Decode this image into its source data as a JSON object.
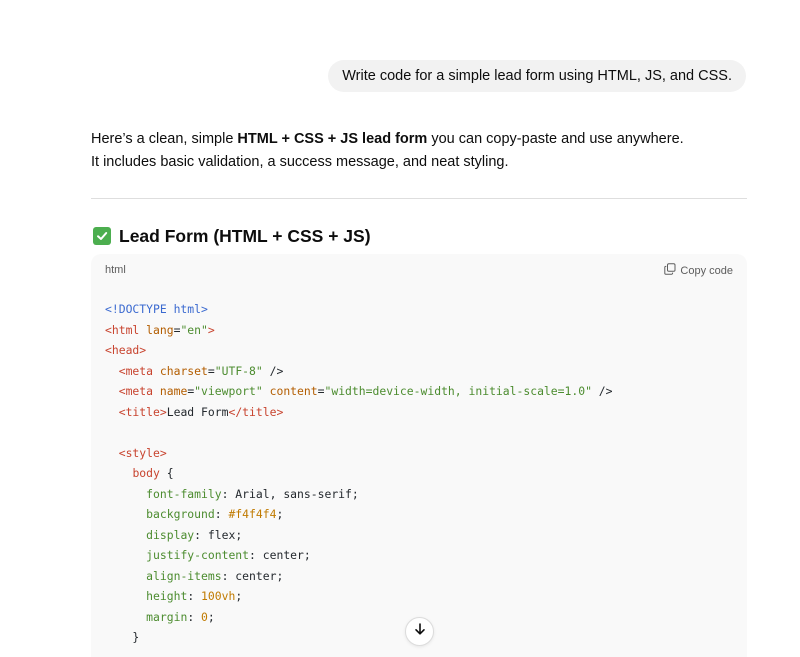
{
  "user_message": "Write code for a simple lead form using HTML, JS, and CSS.",
  "answer": {
    "line1_prefix": "Here’s a clean, simple ",
    "line1_bold": "HTML + CSS + JS lead form",
    "line1_suffix": " you can copy-paste and use anywhere.",
    "line2": "It includes basic validation, a success message, and neat styling."
  },
  "section": {
    "icon": "check-mark-icon",
    "title": "Lead Form (HTML + CSS + JS)"
  },
  "code_block": {
    "language": "html",
    "copy_label": "Copy code",
    "lines": [
      [
        [
          "doc",
          "<!DOCTYPE "
        ],
        [
          "doc",
          "html"
        ],
        [
          "doc",
          ">"
        ]
      ],
      [
        [
          "tag",
          "<html "
        ],
        [
          "attr",
          "lang"
        ],
        [
          "punct",
          "="
        ],
        [
          "str",
          "\"en\""
        ],
        [
          "tag",
          ">"
        ]
      ],
      [
        [
          "tag",
          "<head>"
        ]
      ],
      [
        [
          "punct",
          "  "
        ],
        [
          "tag",
          "<meta "
        ],
        [
          "attr",
          "charset"
        ],
        [
          "punct",
          "="
        ],
        [
          "str",
          "\"UTF-8\""
        ],
        [
          "punct",
          " />"
        ]
      ],
      [
        [
          "punct",
          "  "
        ],
        [
          "tag",
          "<meta "
        ],
        [
          "attr",
          "name"
        ],
        [
          "punct",
          "="
        ],
        [
          "str",
          "\"viewport\""
        ],
        [
          "punct",
          " "
        ],
        [
          "attr",
          "content"
        ],
        [
          "punct",
          "="
        ],
        [
          "str",
          "\"width=device-width, initial-scale=1.0\""
        ],
        [
          "punct",
          " />"
        ]
      ],
      [
        [
          "punct",
          "  "
        ],
        [
          "tag",
          "<title>"
        ],
        [
          "punct",
          "Lead Form"
        ],
        [
          "tag",
          "</title>"
        ]
      ],
      [
        [
          "punct",
          ""
        ]
      ],
      [
        [
          "punct",
          "  "
        ],
        [
          "tag",
          "<style>"
        ]
      ],
      [
        [
          "punct",
          "    "
        ],
        [
          "sel",
          "body"
        ],
        [
          "punct",
          " {"
        ]
      ],
      [
        [
          "punct",
          "      "
        ],
        [
          "prop",
          "font-family"
        ],
        [
          "punct",
          ": Arial, sans-serif;"
        ]
      ],
      [
        [
          "punct",
          "      "
        ],
        [
          "prop",
          "background"
        ],
        [
          "punct",
          ": "
        ],
        [
          "num",
          "#f4f4f4"
        ],
        [
          "punct",
          ";"
        ]
      ],
      [
        [
          "punct",
          "      "
        ],
        [
          "prop",
          "display"
        ],
        [
          "punct",
          ": flex;"
        ]
      ],
      [
        [
          "punct",
          "      "
        ],
        [
          "prop",
          "justify-content"
        ],
        [
          "punct",
          ": center;"
        ]
      ],
      [
        [
          "punct",
          "      "
        ],
        [
          "prop",
          "align-items"
        ],
        [
          "punct",
          ": center;"
        ]
      ],
      [
        [
          "punct",
          "      "
        ],
        [
          "prop",
          "height"
        ],
        [
          "punct",
          ": "
        ],
        [
          "num",
          "100vh"
        ],
        [
          "punct",
          ";"
        ]
      ],
      [
        [
          "punct",
          "      "
        ],
        [
          "prop",
          "margin"
        ],
        [
          "punct",
          ": "
        ],
        [
          "num",
          "0"
        ],
        [
          "punct",
          ";"
        ]
      ],
      [
        [
          "punct",
          "    }"
        ]
      ]
    ]
  },
  "scroll_button": {
    "icon": "arrow-down-icon"
  }
}
